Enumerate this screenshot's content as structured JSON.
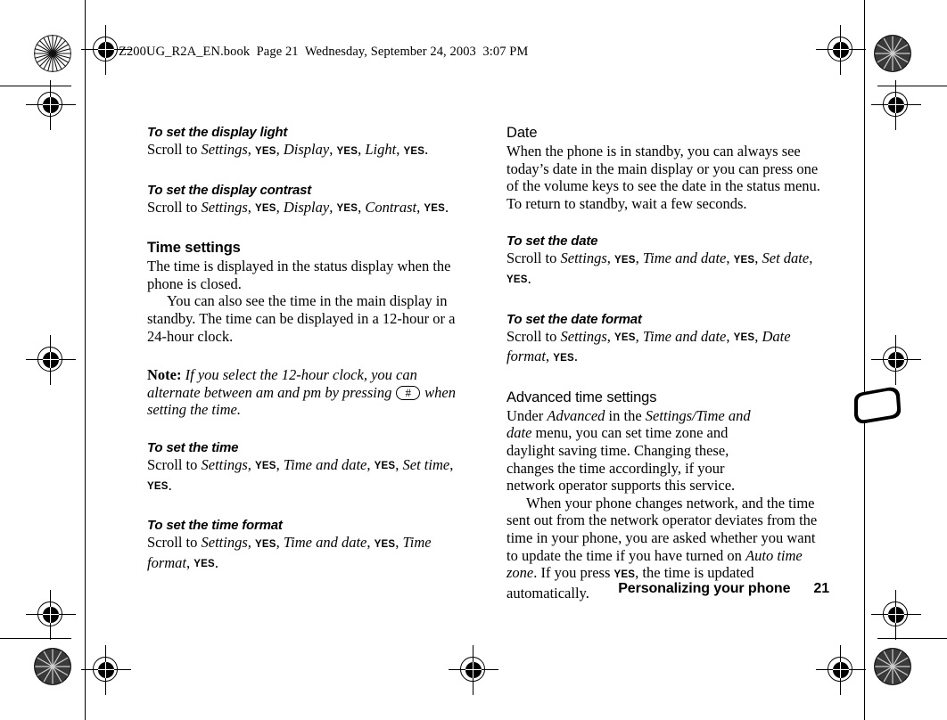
{
  "document": {
    "book_header": "Z200UG_R2A_EN.book  Page 21  Wednesday, September 24, 2003  3:07 PM",
    "footer_title": "Personalizing your phone",
    "page_number": "21"
  },
  "left_column": {
    "display_light": {
      "heading": "To set the display light",
      "scroll_label": "Scroll to ",
      "menu1": "Settings",
      "key1": "YES",
      "menu2": "Display",
      "key2": "YES",
      "menu3": "Light",
      "key3": "YES",
      "sep": ", ",
      "period": "."
    },
    "display_contrast": {
      "heading": "To set the display contrast",
      "scroll_label": "Scroll to ",
      "menu1": "Settings",
      "key1": "YES",
      "menu2": "Display",
      "key2": "YES",
      "menu3": "Contrast",
      "key3": "YES"
    },
    "time_settings": {
      "heading": "Time settings",
      "para1": "The time is displayed in the status display when the phone is closed.",
      "para2": "You can also see the time in the main display in standby. The time can be displayed in a 12-hour or a 24-hour clock."
    },
    "note": {
      "lead": "Note: ",
      "text_before_key": "If you select the 12-hour clock, you can alternate between am and pm by pressing ",
      "keycap": "#",
      "text_after_key": " when setting the time."
    },
    "set_time": {
      "heading": "To set the time",
      "scroll_label": "Scroll to ",
      "menu1": "Settings",
      "key1": "YES",
      "menu2": "Time and date",
      "key2": "YES",
      "menu3": "Set time",
      "key3": "YES"
    },
    "time_format": {
      "heading": "To set the time format",
      "scroll_label": "Scroll to ",
      "menu1": "Settings",
      "key1": "YES",
      "menu2": "Time and date",
      "key2": "YES",
      "menu3": "Time format",
      "key3": "YES"
    }
  },
  "right_column": {
    "date": {
      "heading": "Date",
      "para1": "When the phone is in standby, you can always see today’s date in the main display or you can press one of the volume keys to see the date in the status menu. To return to standby, wait a few seconds."
    },
    "set_date": {
      "heading": "To set the date",
      "scroll_label": "Scroll to ",
      "menu1": "Settings",
      "key1": "YES",
      "menu2": "Time and date",
      "key2": "YES",
      "menu3": "Set date",
      "key3": "YES"
    },
    "date_format": {
      "heading": "To set the date format",
      "scroll_label": "Scroll to ",
      "menu1": "Settings",
      "key1": "YES",
      "menu2": "Time and date",
      "key2": "YES",
      "menu3": "Date format",
      "key3": "YES"
    },
    "advanced": {
      "heading": "Advanced time settings",
      "p1_a": "Under ",
      "p1_menu1": "Advanced",
      "p1_b": " in the ",
      "p1_menu2": "Settings/Time and date",
      "p1_c": " menu, you can set time zone and daylight saving time. Changing these, changes the time accordingly, if your network operator supports this service.",
      "p2_a": "When your phone changes network, and the time sent out from the network operator deviates from the time in your phone, you are asked whether you want to update the time if you have turned on ",
      "p2_menu": "Auto time zone",
      "p2_b": ". If you press ",
      "p2_key": "YES",
      "p2_c": ", the time is updated automatically."
    },
    "margin_icon": "phone-closed-icon"
  }
}
